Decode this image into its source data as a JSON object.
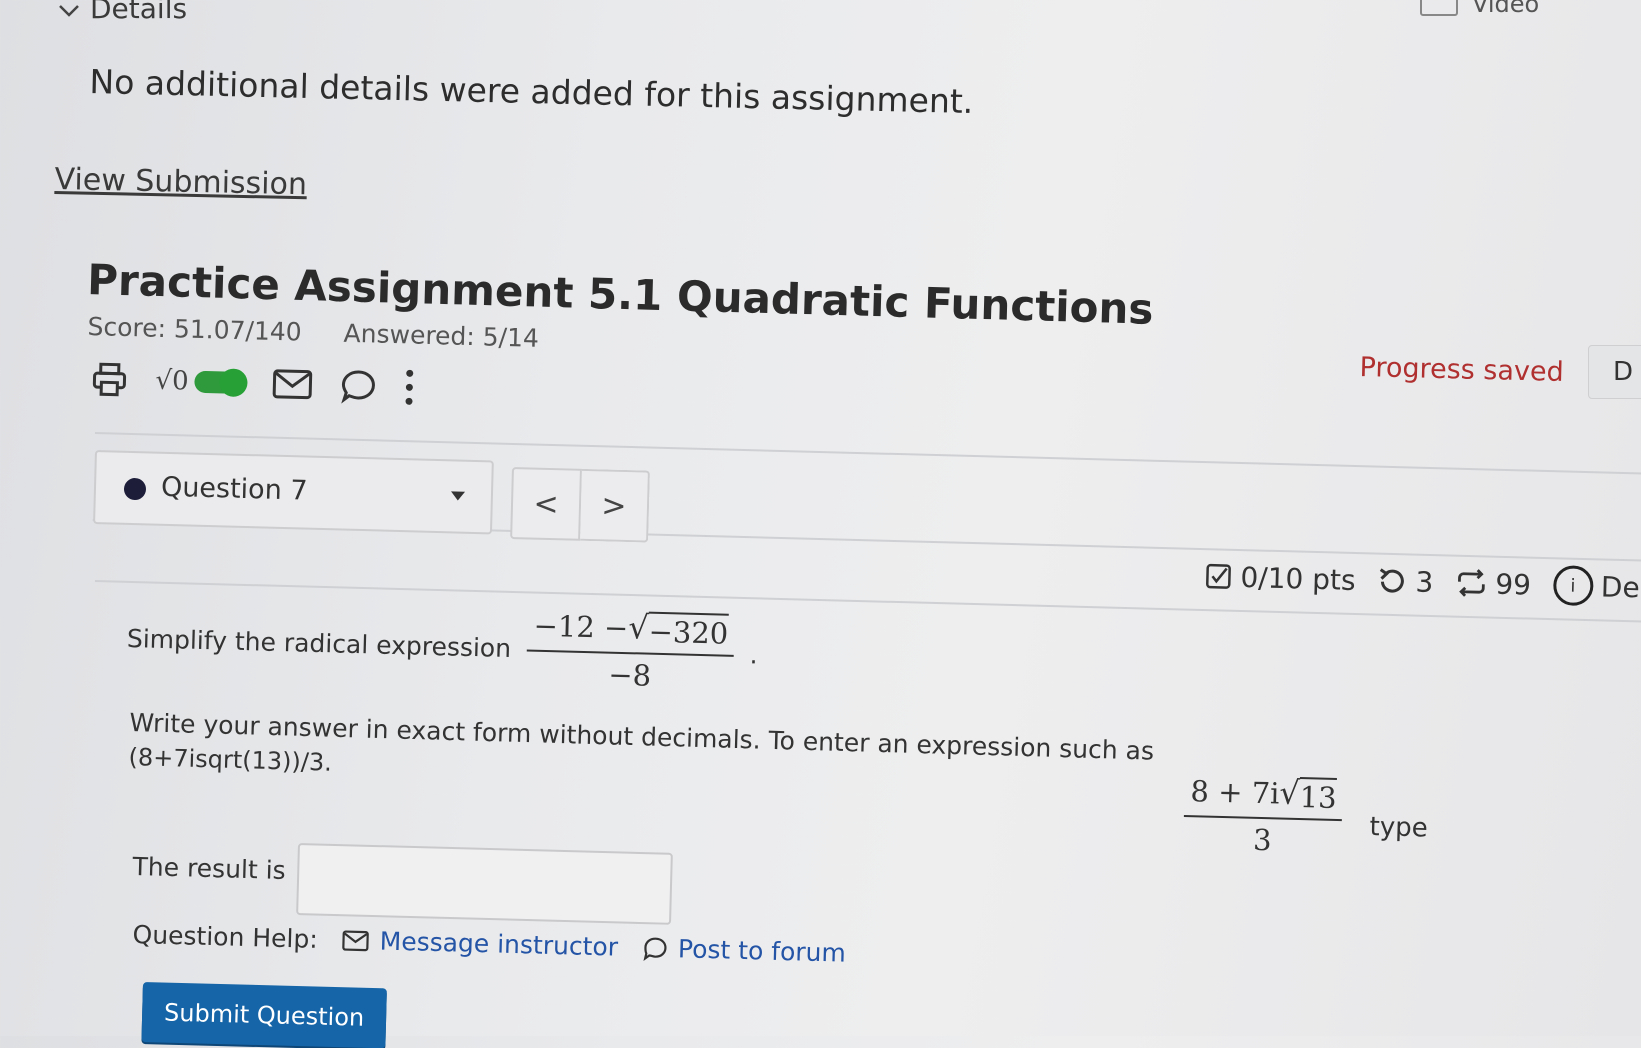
{
  "details": {
    "toggle_label": "Details"
  },
  "top_right": {
    "video_label": "Video"
  },
  "no_details_text": "No additional details were added for this assignment.",
  "view_submission_label": "View Submission",
  "assignment": {
    "title": "Practice Assignment 5.1 Quadratic Functions",
    "score": "Score: 51.07/140",
    "answered": "Answered: 5/14"
  },
  "toolbar": {
    "icons": [
      "printer-icon",
      "sqrt-icon",
      "toggle-switch",
      "mail-icon",
      "chat-icon",
      "more-icon"
    ],
    "sqrt_label": "√0",
    "accent": "#2e9a3b"
  },
  "progress_saved": "Progress saved",
  "d_button_label": "D",
  "question": {
    "selector_label": "Question 7",
    "prev": "<",
    "next": ">",
    "points": "0/10 pts",
    "retries": "3",
    "attempts": "99",
    "details_partial": "De",
    "prompt": "Simplify the radical expression",
    "expr_num_a": "−12 − ",
    "expr_num_rad": "−320",
    "expr_den": "−8",
    "instruction": "Write your answer in exact form without decimals. To enter an expression such as",
    "example_num_a": "8 + 7i",
    "example_num_rad": "13",
    "example_den": "3",
    "type_label": "type",
    "example_code": "(8+7isqrt(13))/3.",
    "result_label": "The result is",
    "answer_value": ""
  },
  "help": {
    "label": "Question Help:",
    "message_label": "Message instructor",
    "forum_label": "Post to forum"
  },
  "submit_label": "Submit Question",
  "colors": {
    "link": "#2454a6",
    "submit": "#1565a8",
    "progress": "#b03030"
  }
}
